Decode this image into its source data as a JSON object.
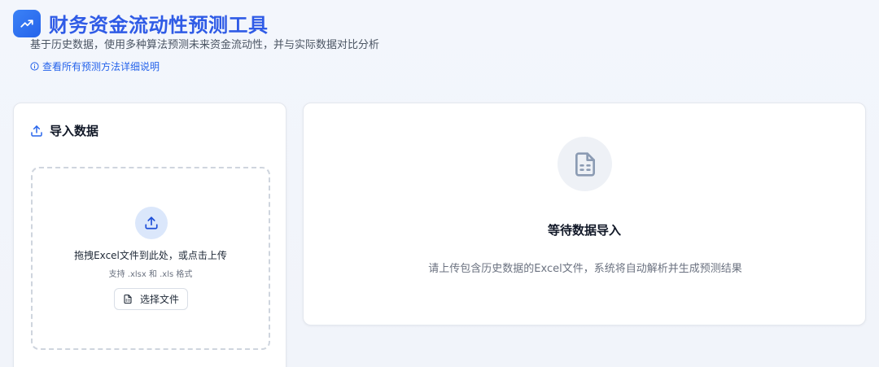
{
  "header": {
    "logo_icon": "trending-up-icon",
    "title": "财务资金流动性预测工具",
    "subtitle": "基于历史数据，使用多种算法预测未来资金流动性，并与实际数据对比分析",
    "method_link": "查看所有预测方法详细说明",
    "accent_color": "#2f5be6"
  },
  "import_panel": {
    "title": "导入数据",
    "title_icon": "upload-icon",
    "dropzone": {
      "icon": "upload-icon",
      "main_text": "拖拽Excel文件到此处，或点击上传",
      "sub_text": "支持 .xlsx 和 .xls 格式",
      "button_label": "选择文件",
      "button_icon": "file-spreadsheet-icon"
    }
  },
  "status_panel": {
    "icon": "file-spreadsheet-icon",
    "title": "等待数据导入",
    "description": "请上传包含历史数据的Excel文件，系统将自动解析并生成预测结果"
  }
}
